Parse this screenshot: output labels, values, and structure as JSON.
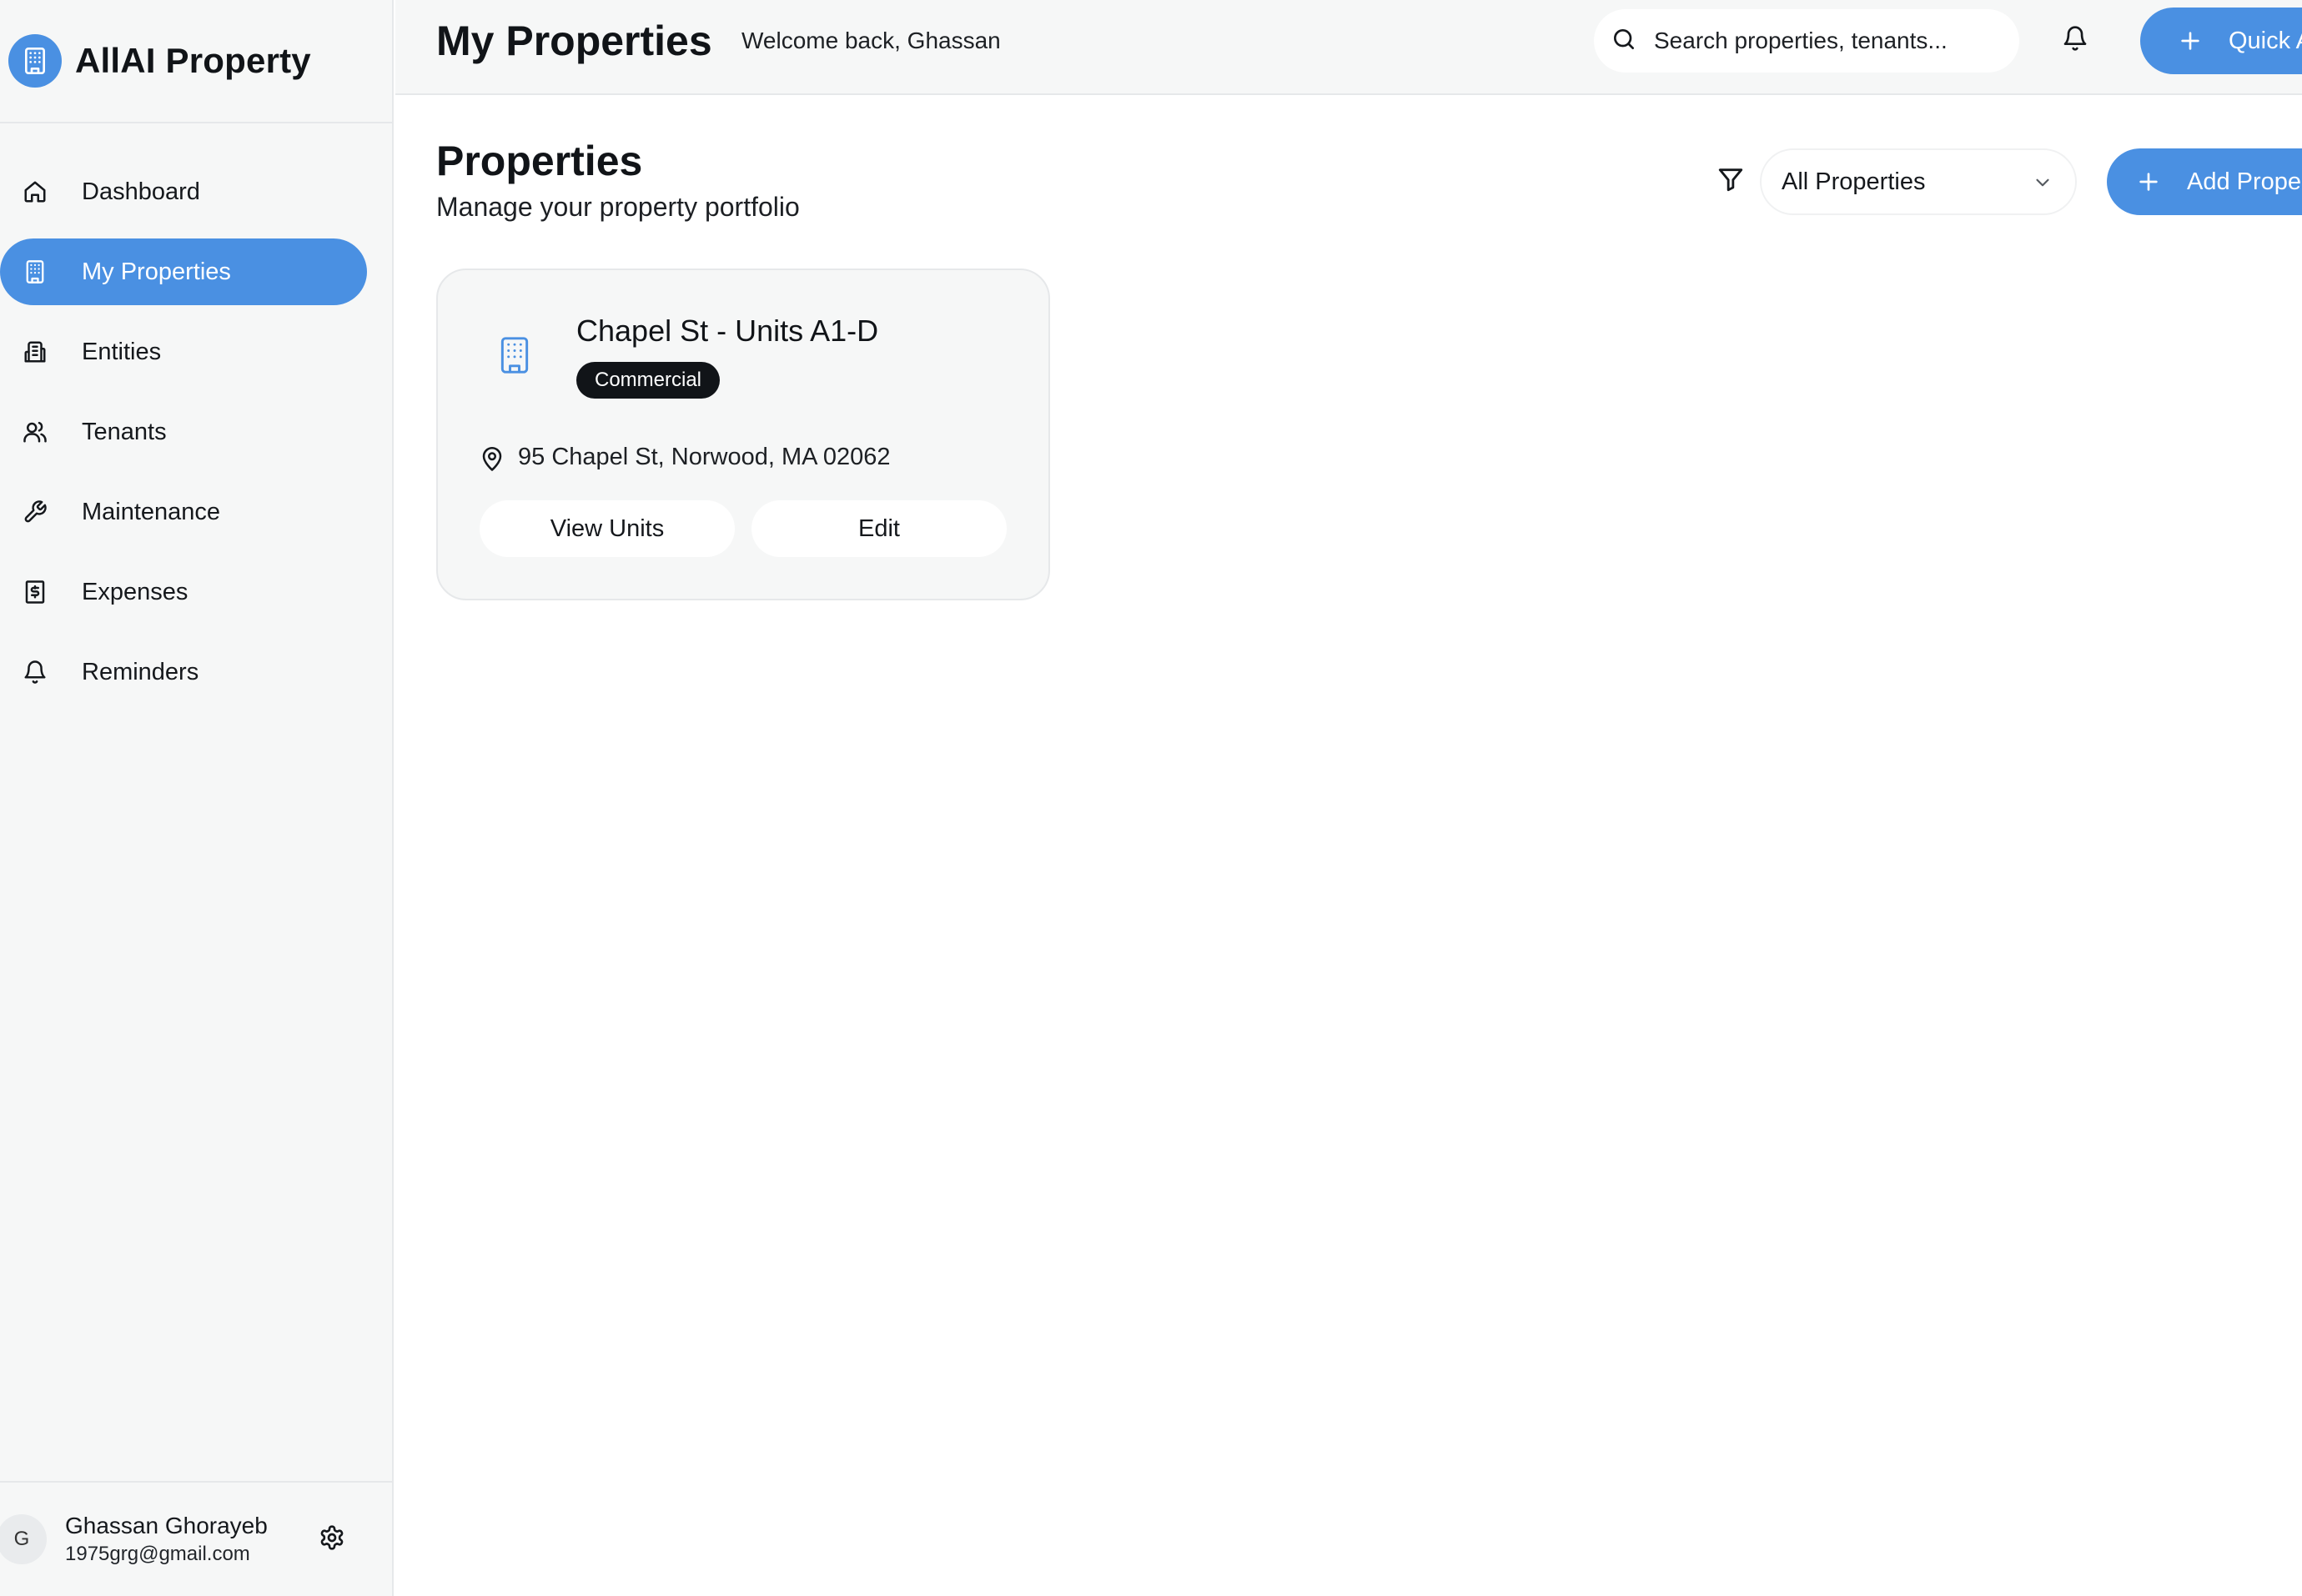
{
  "brand": {
    "name": "AllAI Property",
    "accent_color": "#4a90e2",
    "logo_icon": "building-icon"
  },
  "sidebar": {
    "items": [
      {
        "label": "Dashboard",
        "icon": "home-icon",
        "active": false
      },
      {
        "label": "My Properties",
        "icon": "building-icon",
        "active": true
      },
      {
        "label": "Entities",
        "icon": "entities-icon",
        "active": false
      },
      {
        "label": "Tenants",
        "icon": "users-icon",
        "active": false
      },
      {
        "label": "Maintenance",
        "icon": "wrench-icon",
        "active": false
      },
      {
        "label": "Expenses",
        "icon": "receipt-dollar-icon",
        "active": false
      },
      {
        "label": "Reminders",
        "icon": "bell-icon",
        "active": false
      }
    ]
  },
  "user": {
    "initial": "G",
    "name": "Ghassan Ghorayeb",
    "email": "1975grg@gmail.com"
  },
  "header": {
    "title": "My Properties",
    "welcome": "Welcome back, Ghassan",
    "search_placeholder": "Search properties, tenants...",
    "quick_action_label": "Quick A"
  },
  "main": {
    "title": "Properties",
    "subtitle": "Manage your property portfolio",
    "filter": {
      "selected": "All Properties"
    },
    "add_label": "Add Prope"
  },
  "properties": [
    {
      "name": "Chapel St - Units A1-D",
      "type": "Commercial",
      "address": "95 Chapel St, Norwood, MA 02062",
      "view_label": "View Units",
      "edit_label": "Edit"
    }
  ]
}
